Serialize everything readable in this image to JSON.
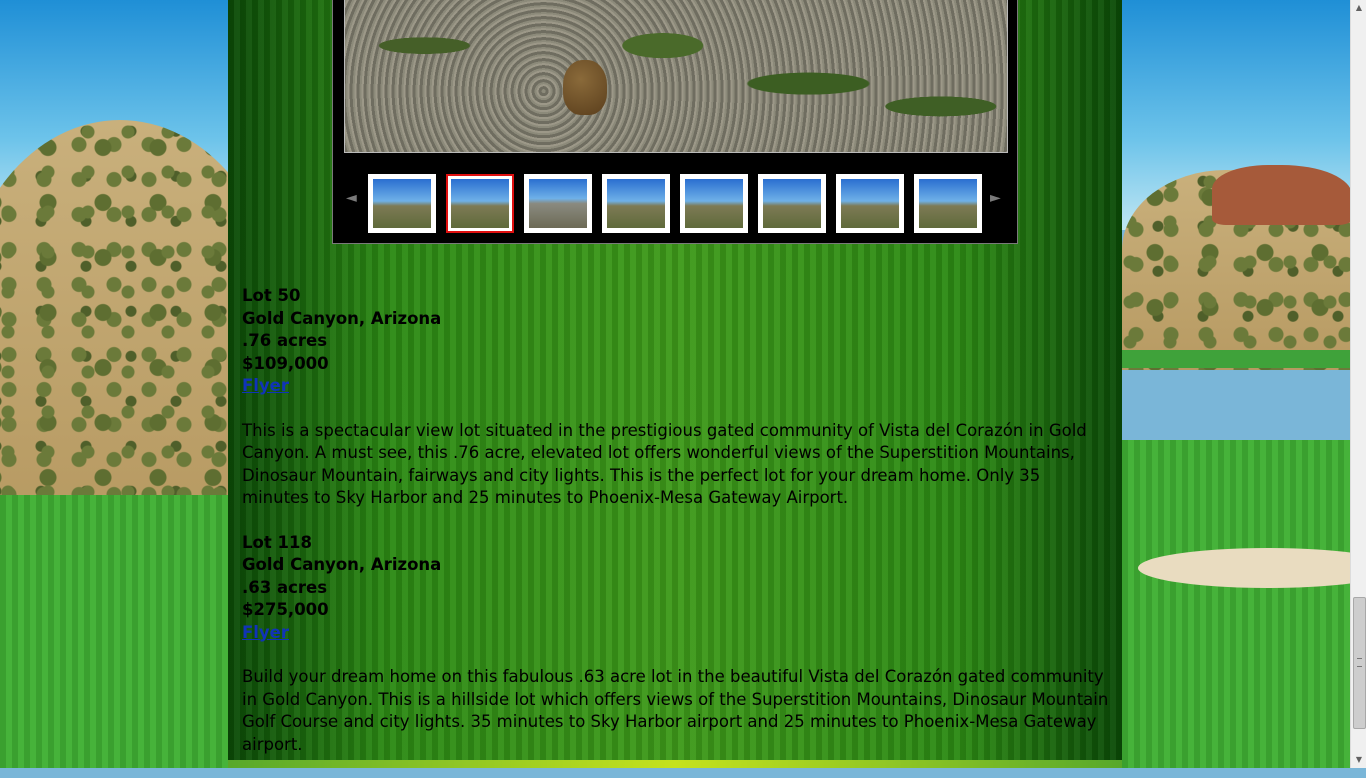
{
  "gallery": {
    "prev_label": "◄",
    "next_label": "►",
    "thumbnails": [
      "thumb-1",
      "thumb-2",
      "thumb-3",
      "thumb-4",
      "thumb-5",
      "thumb-6",
      "thumb-7",
      "thumb-8"
    ],
    "selected_index": 1
  },
  "listings": [
    {
      "lot": "Lot 50",
      "location": "Gold Canyon, Arizona",
      "acres": ".76 acres",
      "price": "$109,000",
      "flyer": "Flyer",
      "description": "This is a spectacular view lot situated in the prestigious gated community of Vista del Corazón in Gold Canyon. A must see, this .76 acre, elevated lot offers wonderful views of the Superstition Mountains, Dinosaur Mountain, fairways and city lights. This is the perfect lot for your dream home. Only 35 minutes to Sky Harbor and 25 minutes to Phoenix-Mesa Gateway Airport."
    },
    {
      "lot": "Lot 118",
      "location": "Gold Canyon, Arizona",
      "acres": ".63 acres",
      "price": "$275,000",
      "flyer": "Flyer",
      "description": "Build your dream home on this fabulous .63 acre lot in the beautiful Vista del Corazón gated community in Gold Canyon. This is a hillside lot which offers views of the Superstition Mountains, Dinosaur Mountain Golf Course and city lights. 35 minutes to Sky Harbor airport and 25 minutes to Phoenix-Mesa Gateway airport."
    }
  ],
  "colors": {
    "link": "#1033b8",
    "selected_thumb_border": "#e01010",
    "column_green": "#3e9a1a"
  }
}
